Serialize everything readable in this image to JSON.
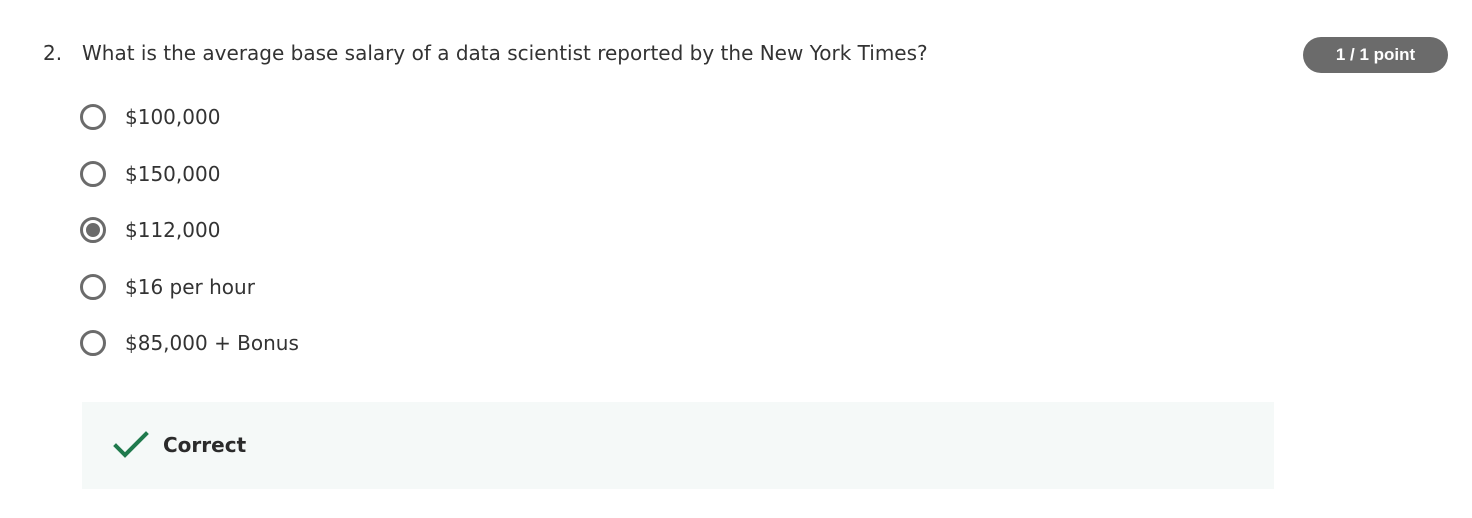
{
  "question": {
    "number": "2.",
    "text": "What is the average base salary of a data scientist reported by the New York Times?",
    "points": "1 / 1 point"
  },
  "options": [
    {
      "label": "$100,000",
      "selected": false
    },
    {
      "label": "$150,000",
      "selected": false
    },
    {
      "label": "$112,000",
      "selected": true
    },
    {
      "label": "$16 per hour",
      "selected": false
    },
    {
      "label": "$85,000 + Bonus",
      "selected": false
    }
  ],
  "feedback": {
    "label": "Correct",
    "icon": "checkmark-icon",
    "color": "#1f7a4d"
  },
  "colors": {
    "badge_bg": "#6b6b6b",
    "radio": "#6b6b6b",
    "feedback_bg": "#f5f9f8"
  }
}
